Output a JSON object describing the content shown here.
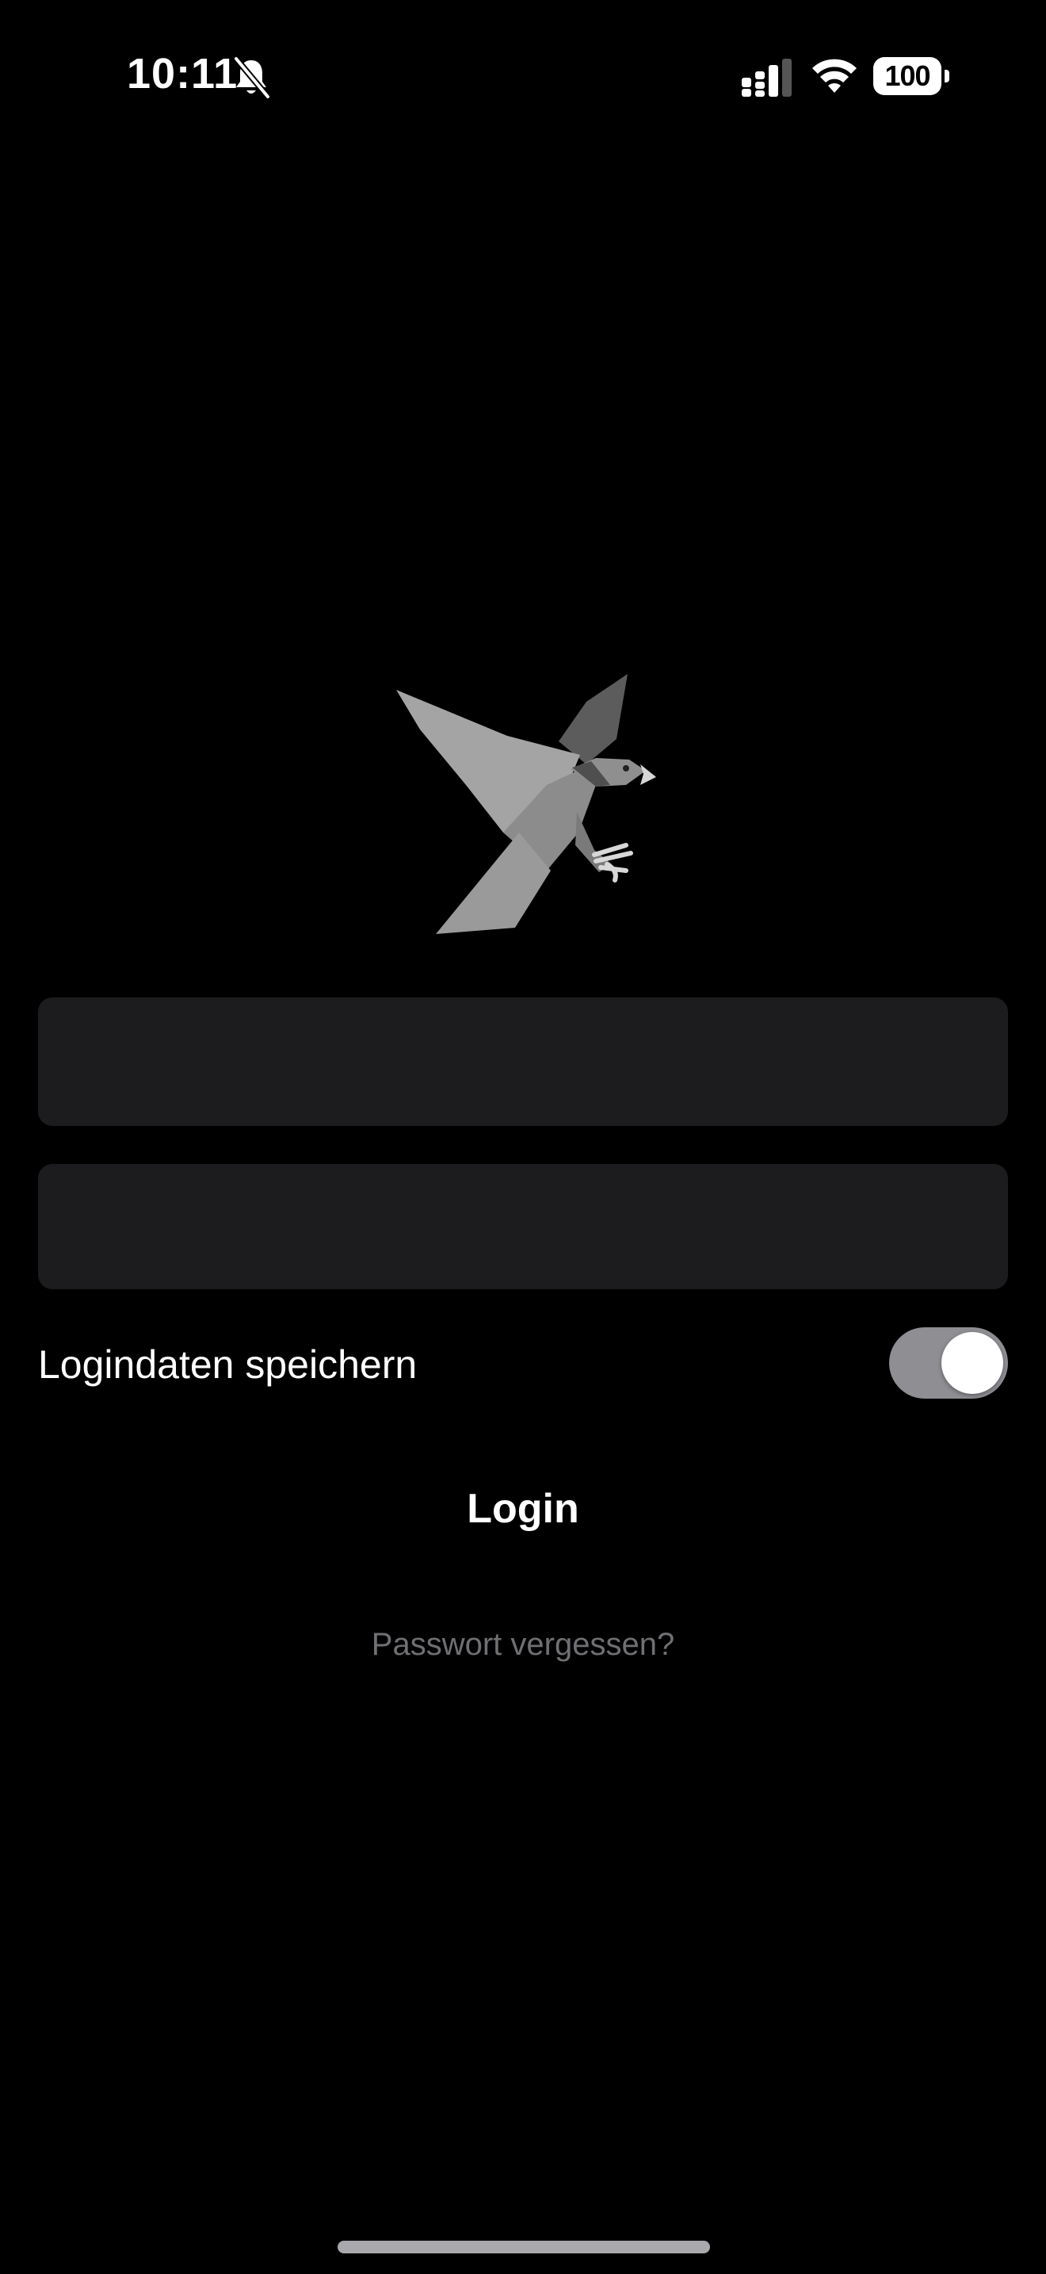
{
  "status_bar": {
    "time": "10:11",
    "battery": "100",
    "icons": [
      "bell-slash-icon",
      "cellular-signal-icon",
      "wifi-icon",
      "battery-icon"
    ]
  },
  "logo": {
    "icon": "eagle-logo",
    "colors": {
      "wing_light": "#a4a4a4",
      "wing_dark": "#5c5c5c",
      "body": "#8c8c8c",
      "tail": "#9a9a9a",
      "talon": "#d8d8d8"
    }
  },
  "form": {
    "username_placeholder": "",
    "password_placeholder": "",
    "remember_label": "Logindaten speichern",
    "remember_enabled": true,
    "login_label": "Login",
    "forgot_label": "Passwort vergessen?"
  },
  "colors": {
    "background": "#000000",
    "field_background": "#1c1c1e",
    "toggle_track": "#8e8e93",
    "muted_text": "#6f6f74"
  }
}
